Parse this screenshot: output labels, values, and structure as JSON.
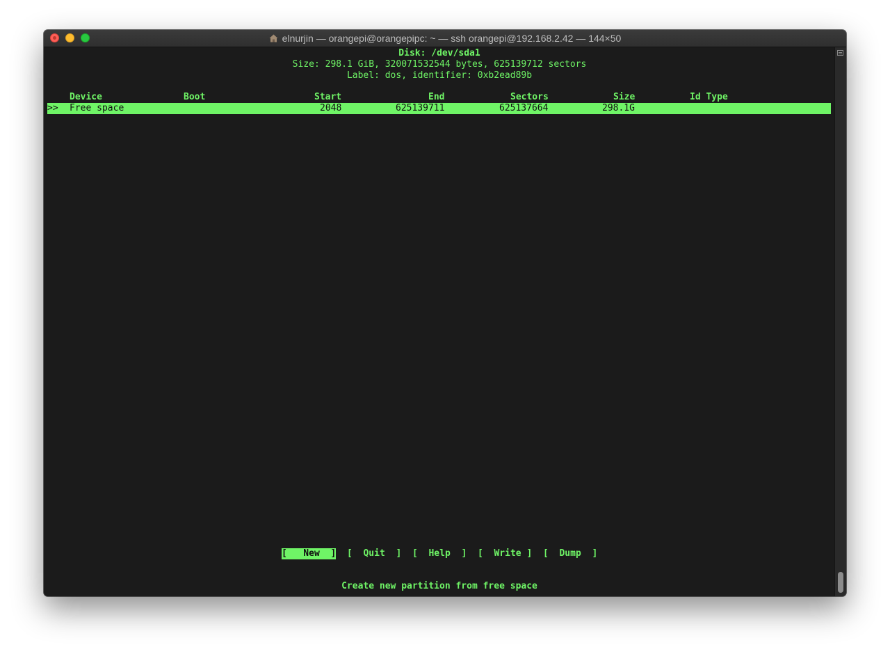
{
  "window": {
    "title": "elnurjin — orangepi@orangepipc: ~ — ssh orangepi@192.168.2.42 — 144×50"
  },
  "disk": {
    "heading": "Disk: /dev/sda1",
    "size_line": "Size: 298.1 GiB, 320071532544 bytes, 625139712 sectors",
    "label_line": "Label: dos, identifier: 0xb2ead89b"
  },
  "table": {
    "headers": {
      "device": "Device",
      "boot": "Boot",
      "start": "Start",
      "end": "End",
      "sectors": "Sectors",
      "size": "Size",
      "id_type": "Id Type"
    },
    "rows": [
      {
        "marker": ">>",
        "device": "Free space",
        "boot": "",
        "start": "2048",
        "end": "625139711",
        "sectors": "625137664",
        "size": "298.1G",
        "id_type": ""
      }
    ]
  },
  "menu": {
    "new": "[   New  ]",
    "quit": "[  Quit  ]",
    "help": "[  Help  ]",
    "write": "[  Write ]",
    "dump": "[  Dump  ]",
    "selected": "New"
  },
  "status": {
    "hint": "Create new partition from free space"
  },
  "colors": {
    "terminal_bg": "#1b1b1b",
    "terminal_fg": "#6ff466"
  },
  "icons": {
    "title": "home-icon",
    "scroll": "scroll-icon"
  }
}
